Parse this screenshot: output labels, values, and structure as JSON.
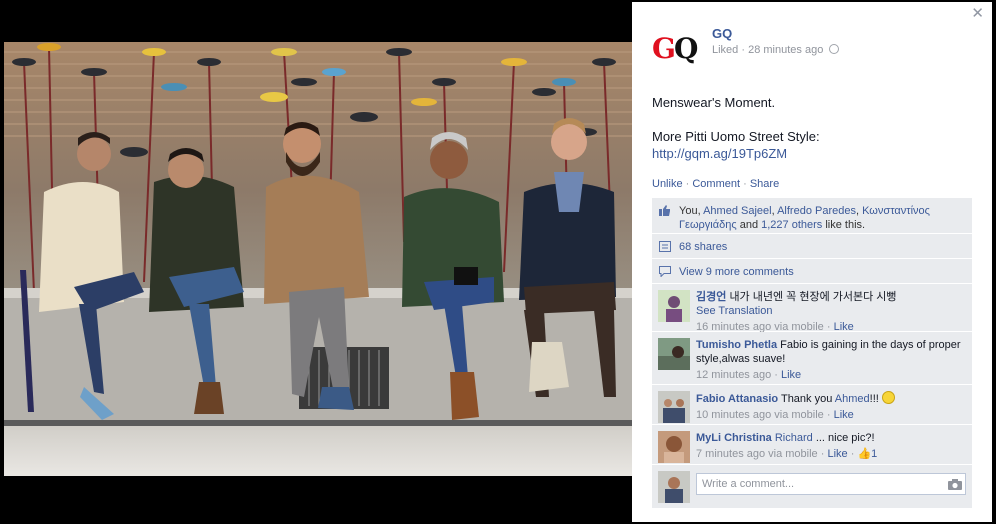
{
  "post": {
    "page_name": "GQ",
    "logo_text": "GQ",
    "status": "Liked",
    "timestamp": "28 minutes ago",
    "text_line1": "Menswear's Moment.",
    "text_line2": "More Pitti Uomo Street Style:",
    "link": "http://gqm.ag/19Tp6ZM"
  },
  "actions": {
    "unlike": "Unlike",
    "comment": "Comment",
    "share": "Share",
    "separator": " · "
  },
  "likes": {
    "prefix": "You, ",
    "name1": "Ahmed Sajeel",
    "name2": "Alfredo Paredes",
    "name3": "Κωνσταντίνος Γεωργιάδης",
    "mid": " and ",
    "others": "1,227 others",
    "suffix": " like this."
  },
  "shares": "68 shares",
  "view_more": "View 9 more comments",
  "comments": [
    {
      "name": "김경언",
      "text": "내가 내년엔 꼭 현장에 가서본다 시뻥",
      "translate": "See Translation",
      "time": "16 minutes ago via mobile",
      "like": "Like"
    },
    {
      "name": "Tumisho Phetla",
      "text": "Fabio is gaining in the days of proper style,alwas suave!",
      "time": "12 minutes ago",
      "like": "Like"
    },
    {
      "name": "Fabio Attanasio",
      "text_pre": "Thank you ",
      "mention": "Ahmed",
      "text_post": "!!!",
      "time": "10 minutes ago via mobile",
      "like": "Like"
    },
    {
      "name": "MyLi Christina",
      "mention": "Richard",
      "text_post": " ... nice pic?!",
      "time": "7 minutes ago via mobile",
      "like": "Like",
      "like_count": "1"
    }
  ],
  "compose": {
    "placeholder": "Write a comment..."
  },
  "icons": {
    "close": "close-icon",
    "globe": "globe-icon",
    "thumbs_up": "thumbs-up-icon",
    "shares": "shares-icon",
    "comments": "comments-icon",
    "camera": "camera-icon",
    "smile": "smile-emoticon-icon"
  },
  "colors": {
    "link": "#3b5998",
    "meta": "#90949c",
    "feedback_bg": "#e9ebee",
    "logo_red": "#e0101f"
  }
}
